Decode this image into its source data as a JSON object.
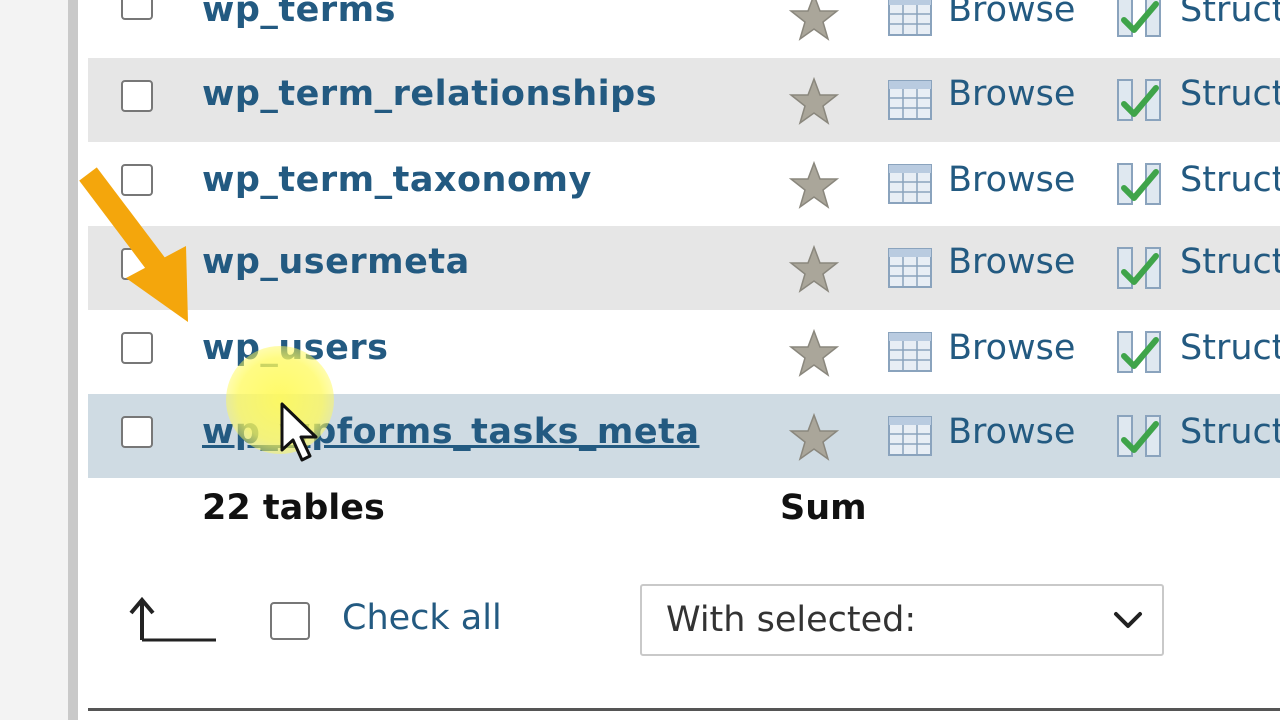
{
  "tables": {
    "rows": [
      {
        "name": "wp_terms",
        "action1": "Browse",
        "action2": "Struct"
      },
      {
        "name": "wp_term_relationships",
        "action1": "Browse",
        "action2": "Struct"
      },
      {
        "name": "wp_term_taxonomy",
        "action1": "Browse",
        "action2": "Struct"
      },
      {
        "name": "wp_usermeta",
        "action1": "Browse",
        "action2": "Struct"
      },
      {
        "name": "wp_users",
        "action1": "Browse",
        "action2": "Struct"
      },
      {
        "name": "wp_wpforms_tasks_meta",
        "action1": "Browse",
        "action2": "Struct"
      }
    ],
    "summary": {
      "count_label": "22 tables",
      "sum_label": "Sum"
    }
  },
  "footer": {
    "check_all_label": "Check all",
    "with_selected": "With selected:"
  },
  "colors": {
    "link": "#235a81",
    "row_alt": "#e6e6e6",
    "row_hover": "#cfdbe3",
    "annotation_arrow": "#f4a60c",
    "cursor_highlight": "#fffa5a"
  },
  "icons": {
    "favorite": "star-icon",
    "browse": "browse-table-icon",
    "structure": "structure-icon",
    "select_all_arrow": "arrow-up-left-icon",
    "dropdown": "chevron-down-icon"
  }
}
